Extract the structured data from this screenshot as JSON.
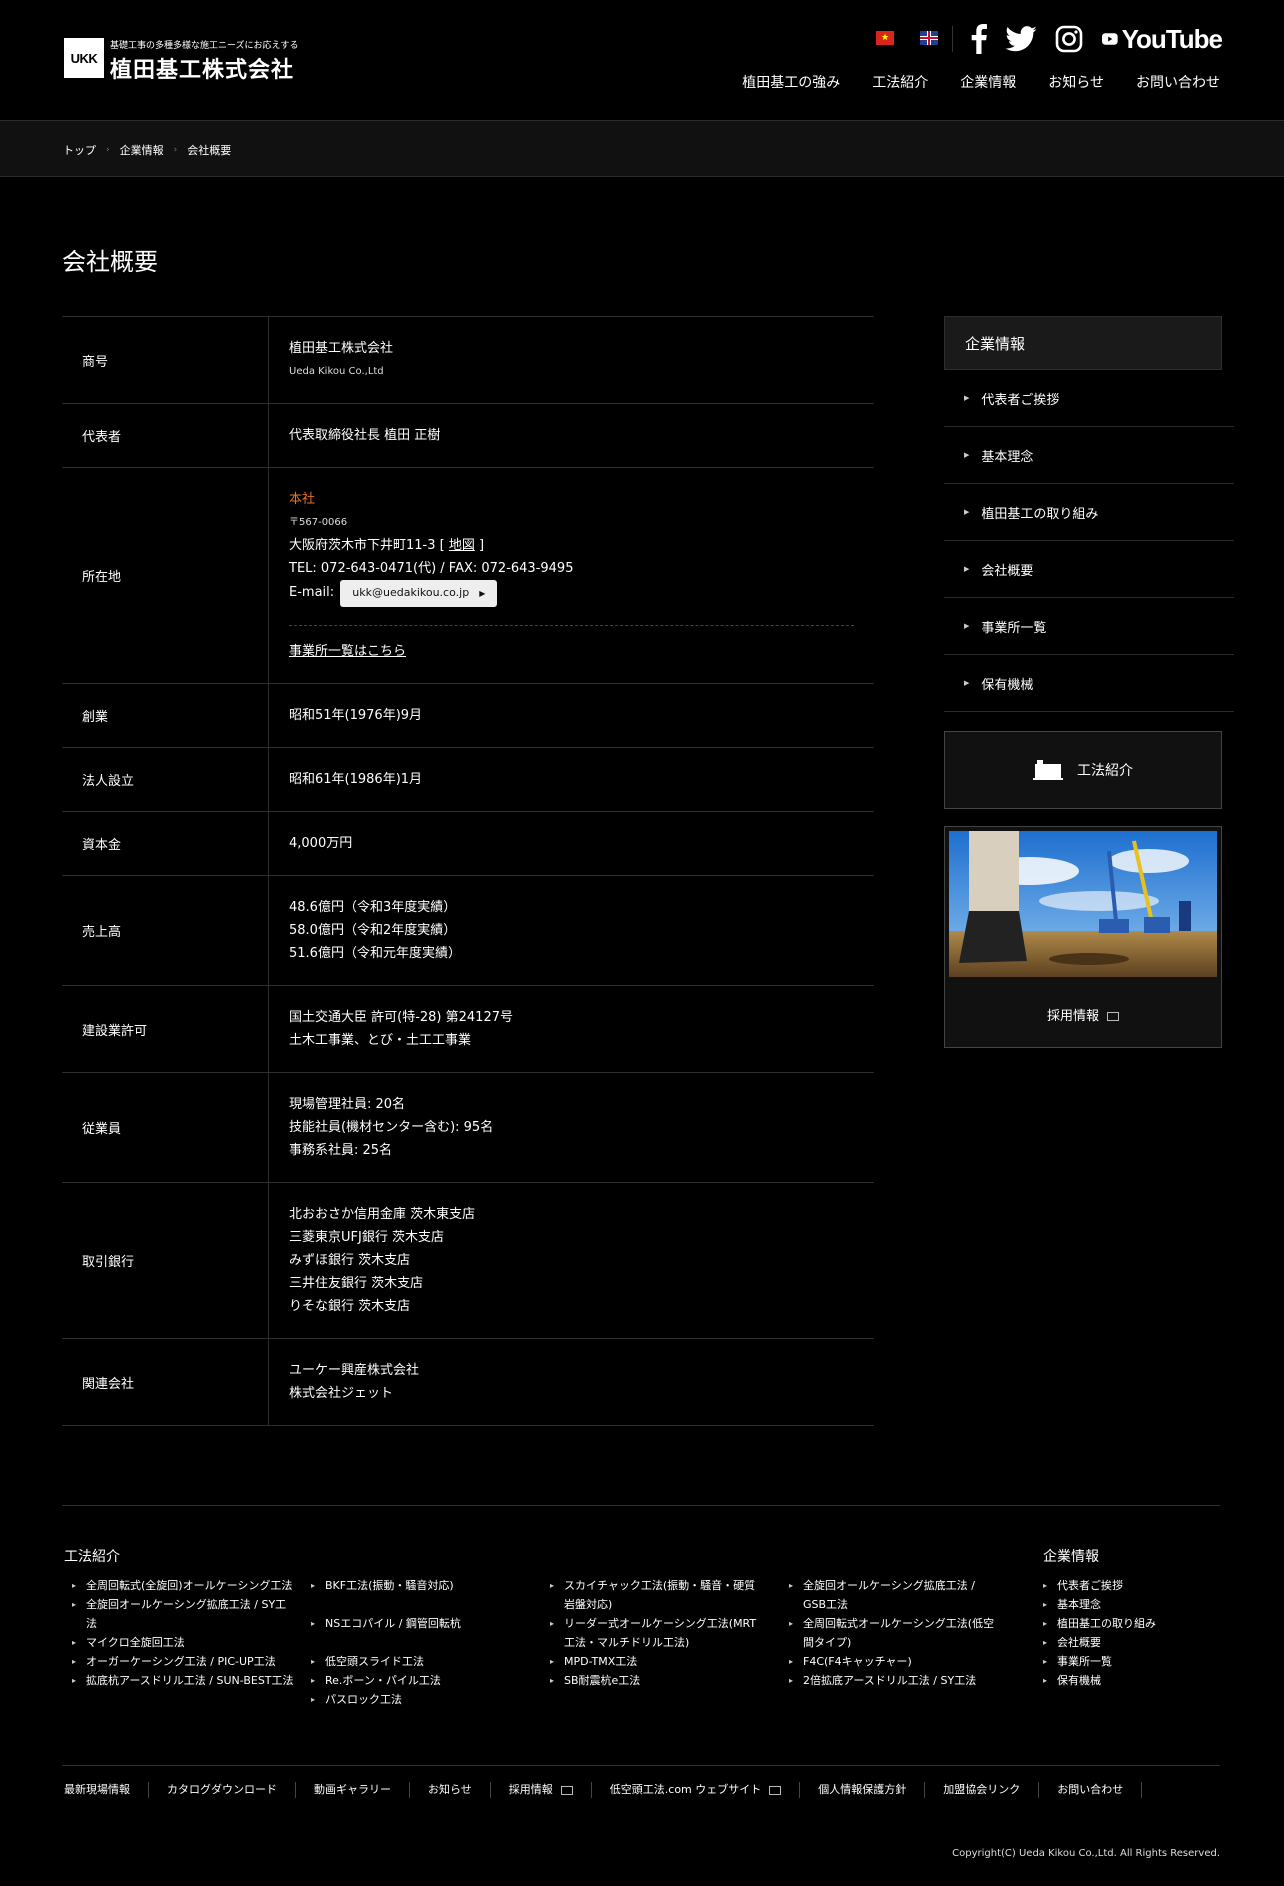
{
  "header": {
    "logo_mark": "UKK",
    "tagline": "基礎工事の多種多様な施工ニーズにお応えする",
    "company_name": "植田基工株式会社",
    "youtube_text": "YouTube",
    "nav": [
      "植田基工の強み",
      "工法紹介",
      "企業情報",
      "お知らせ",
      "お問い合わせ"
    ]
  },
  "breadcrumb": [
    "トップ",
    "企業情報",
    "会社概要"
  ],
  "page_title": "会社概要",
  "table": {
    "rows": [
      {
        "label": "商号"
      },
      {
        "label": "代表者"
      },
      {
        "label": "所在地"
      },
      {
        "label": "創業"
      },
      {
        "label": "法人設立"
      },
      {
        "label": "資本金"
      },
      {
        "label": "売上高"
      },
      {
        "label": "建設業許可"
      },
      {
        "label": "従業員"
      },
      {
        "label": "取引銀行"
      },
      {
        "label": "関連会社"
      }
    ],
    "company_name": "植田基工株式会社",
    "company_name_en": "Ueda Kikou Co.,Ltd",
    "representative": "代表取締役社長 植田 正樹",
    "address": {
      "head_office": "本社",
      "postal": "〒567-0066",
      "street": "大阪府茨木市下井町11-3",
      "map_link": "地図",
      "tel_fax": "TEL: 072-643-0471(代) / FAX: 072-643-9495",
      "email_label": "E-mail:",
      "email": "ukk@uedakikou.co.jp",
      "offices_link": "事業所一覧はこちら"
    },
    "founded": "昭和51年(1976年)9月",
    "incorporated": "昭和61年(1986年)1月",
    "capital": "4,000万円",
    "sales": [
      "48.6億円（令和3年度実績）",
      "58.0億円（令和2年度実績）",
      "51.6億円（令和元年度実績）"
    ],
    "license": [
      "国土交通大臣 許可(特-28) 第24127号",
      "土木工事業、とび・土工工事業"
    ],
    "employees": [
      "現場管理社員: 20名",
      "技能社員(機材センター含む): 95名",
      "事務系社員: 25名"
    ],
    "banks": [
      "北おおさか信用金庫 茨木東支店",
      "三菱東京UFJ銀行 茨木支店",
      "みずほ銀行 茨木支店",
      "三井住友銀行 茨木支店",
      "りそな銀行 茨木支店"
    ],
    "affiliates": [
      "ユーケー興産株式会社",
      "株式会社ジェット"
    ]
  },
  "sidebar": {
    "heading": "企業情報",
    "items": [
      "代表者ご挨拶",
      "基本理念",
      "植田基工の取り組み",
      "会社概要",
      "事業所一覧",
      "保有機械"
    ],
    "banner_method": "工法紹介",
    "banner_recruit": "採用情報"
  },
  "footer": {
    "methods_title": "工法紹介",
    "methods_col1": [
      "全周回転式(全旋回)オールケーシング工法",
      "全旋回オールケーシング拡底工法 / SY工法",
      "マイクロ全旋回工法",
      "オーガーケーシング工法 / PIC-UP工法",
      "拡底杭アースドリル工法 / SUN-BEST工法"
    ],
    "methods_col2": [
      "BKF工法(振動・騒音対応)",
      "NSエコパイル / 鋼管回転杭",
      "低空頭スライド工法",
      "Re.ボーン・パイル工法",
      "パスロック工法"
    ],
    "methods_col3": [
      "スカイチャック工法(振動・騒音・硬質岩盤対応)",
      "リーダー式オールケーシング工法(MRT工法・マルチドリル工法)",
      "MPD-TMX工法",
      "SB耐震杭e工法"
    ],
    "methods_col4": [
      "全旋回オールケーシング拡底工法 / GSB工法",
      "全周回転式オールケーシング工法(低空間タイプ)",
      "F4C(F4キャッチャー)",
      "2倍拡底アースドリル工法 / SY工法"
    ],
    "company_title": "企業情報",
    "company_items": [
      "代表者ご挨拶",
      "基本理念",
      "植田基工の取り組み",
      "会社概要",
      "事業所一覧",
      "保有機械"
    ],
    "links": [
      "最新現場情報",
      "カタログダウンロード",
      "動画ギャラリー",
      "お知らせ",
      "採用情報",
      "低空頭工法.com ウェブサイト",
      "個人情報保護方針",
      "加盟協会リンク",
      "お問い合わせ"
    ],
    "copyright": "Copyright(C) Ueda Kikou Co.,Ltd. All Rights Reserved."
  }
}
